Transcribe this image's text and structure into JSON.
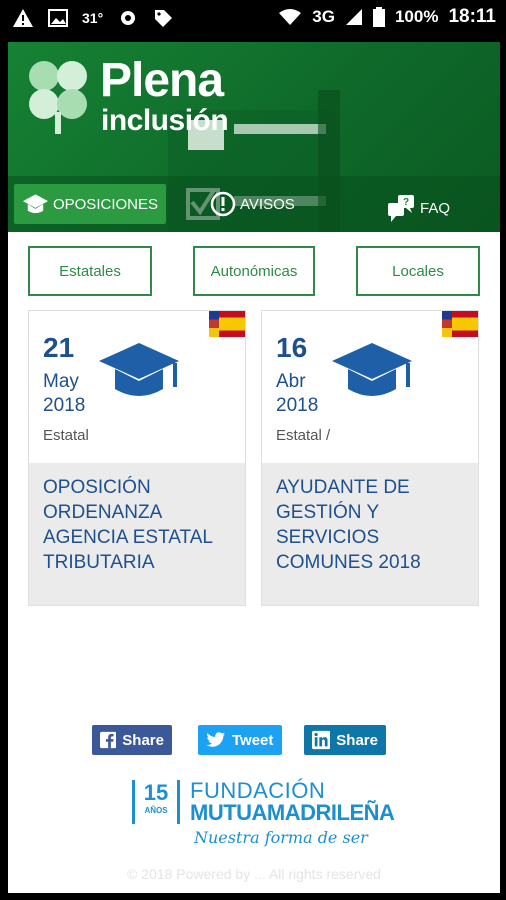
{
  "status_bar": {
    "temperature": "31°",
    "network": "3G",
    "battery": "100%",
    "time": "18:11"
  },
  "app": {
    "logo_title": "Plena",
    "logo_subtitle": "inclusión"
  },
  "nav": {
    "items": [
      {
        "label": "OPOSICIONES",
        "icon": "graduation-cap-icon",
        "active": true
      },
      {
        "label": "AVISOS",
        "icon": "alert-icon",
        "active": false
      },
      {
        "label": "FAQ",
        "icon": "chat-bubbles-icon",
        "active": false
      }
    ]
  },
  "filters": [
    "Estatales",
    "Autonómicas",
    "Locales"
  ],
  "cards": [
    {
      "day": "21",
      "month": "May",
      "year": "2018",
      "scope": "Estatal",
      "title": "OPOSICIÓN ORDENANZA AGENCIA ESTATAL TRIBUTARIA"
    },
    {
      "day": "16",
      "month": "Abr",
      "year": "2018",
      "scope": "Estatal /",
      "title": "AYUDANTE DE GESTIÓN Y SERVICIOS COMUNES 2018"
    }
  ],
  "share": {
    "facebook": "Share",
    "twitter": "Tweet",
    "linkedin": "Share"
  },
  "footer": {
    "years": "15",
    "years_label": "AÑOS",
    "name_line1": "FUNDACIÓN",
    "name_line2": "MUTUAMADRILEÑA",
    "tagline": "Nuestra forma de ser",
    "copyright": "© 2018 Powered by ...  All rights reserved"
  },
  "colors": {
    "brand_green": "#168234",
    "title_blue": "#1e4f8f",
    "filter_border": "#2e8b47"
  }
}
